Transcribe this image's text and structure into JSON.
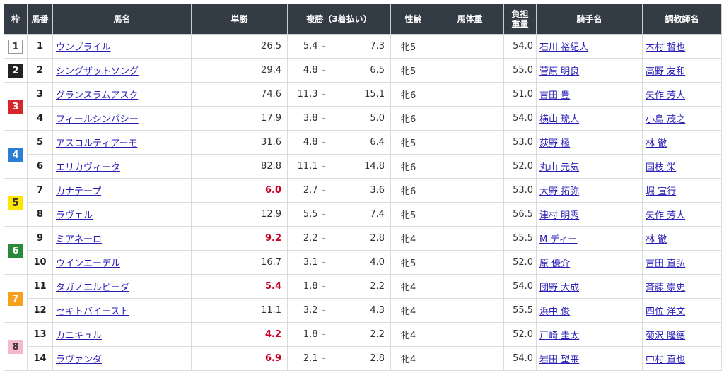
{
  "headers": {
    "waku": "枠",
    "umaban": "馬番",
    "name": "馬名",
    "tansho": "単勝",
    "fukusho": "複勝（3着払い）",
    "sexage": "性齢",
    "bodyweight": "馬体重",
    "weight_line1": "負担",
    "weight_line2": "重量",
    "jockey": "騎手名",
    "trainer": "調教師名"
  },
  "waku_colors": {
    "1": {
      "bg": "#ffffff",
      "fg": "#333333",
      "border": "#999999"
    },
    "2": {
      "bg": "#222222",
      "fg": "#ffffff",
      "border": "#222222"
    },
    "3": {
      "bg": "#d8262d",
      "fg": "#ffffff",
      "border": "#d8262d"
    },
    "4": {
      "bg": "#2a7fd4",
      "fg": "#ffffff",
      "border": "#2a7fd4"
    },
    "5": {
      "bg": "#ffe600",
      "fg": "#333333",
      "border": "#ffe600"
    },
    "6": {
      "bg": "#2a8a3a",
      "fg": "#ffffff",
      "border": "#2a8a3a"
    },
    "7": {
      "bg": "#f7a01e",
      "fg": "#ffffff",
      "border": "#f7a01e"
    },
    "8": {
      "bg": "#f5b8cc",
      "fg": "#333333",
      "border": "#f5b8cc"
    }
  },
  "rows": [
    {
      "waku": "1",
      "umaban": "1",
      "name": "ウンブライル",
      "tansho": "26.5",
      "popular": false,
      "fuku_min": "5.4",
      "fuku_max": "7.3",
      "sexage": "牝5",
      "bodyweight": "",
      "weight": "54.0",
      "jockey": "石川 裕紀人",
      "trainer": "木村 哲也"
    },
    {
      "waku": "2",
      "umaban": "2",
      "name": "シングザットソング",
      "tansho": "29.4",
      "popular": false,
      "fuku_min": "4.8",
      "fuku_max": "6.5",
      "sexage": "牝5",
      "bodyweight": "",
      "weight": "55.0",
      "jockey": "菅原 明良",
      "trainer": "高野 友和"
    },
    {
      "waku": "3",
      "umaban": "3",
      "name": "グランスラムアスク",
      "tansho": "74.6",
      "popular": false,
      "fuku_min": "11.3",
      "fuku_max": "15.1",
      "sexage": "牝6",
      "bodyweight": "",
      "weight": "51.0",
      "jockey": "吉田 豊",
      "trainer": "矢作 芳人"
    },
    {
      "waku": "3",
      "umaban": "4",
      "name": "フィールシンパシー",
      "tansho": "17.9",
      "popular": false,
      "fuku_min": "3.8",
      "fuku_max": "5.0",
      "sexage": "牝6",
      "bodyweight": "",
      "weight": "54.0",
      "jockey": "横山 琉人",
      "trainer": "小島 茂之"
    },
    {
      "waku": "4",
      "umaban": "5",
      "name": "アスコルティアーモ",
      "tansho": "31.6",
      "popular": false,
      "fuku_min": "4.8",
      "fuku_max": "6.4",
      "sexage": "牝5",
      "bodyweight": "",
      "weight": "53.0",
      "jockey": "荻野 極",
      "trainer": "林 徹"
    },
    {
      "waku": "4",
      "umaban": "6",
      "name": "エリカヴィータ",
      "tansho": "82.8",
      "popular": false,
      "fuku_min": "11.1",
      "fuku_max": "14.8",
      "sexage": "牝6",
      "bodyweight": "",
      "weight": "52.0",
      "jockey": "丸山 元気",
      "trainer": "国枝 栄"
    },
    {
      "waku": "5",
      "umaban": "7",
      "name": "カナテープ",
      "tansho": "6.0",
      "popular": true,
      "fuku_min": "2.7",
      "fuku_max": "3.6",
      "sexage": "牝6",
      "bodyweight": "",
      "weight": "53.0",
      "jockey": "大野 拓弥",
      "trainer": "堀 宣行"
    },
    {
      "waku": "5",
      "umaban": "8",
      "name": "ラヴェル",
      "tansho": "12.9",
      "popular": false,
      "fuku_min": "5.5",
      "fuku_max": "7.4",
      "sexage": "牝5",
      "bodyweight": "",
      "weight": "56.5",
      "jockey": "津村 明秀",
      "trainer": "矢作 芳人"
    },
    {
      "waku": "6",
      "umaban": "9",
      "name": "ミアネーロ",
      "tansho": "9.2",
      "popular": true,
      "fuku_min": "2.2",
      "fuku_max": "2.8",
      "sexage": "牝4",
      "bodyweight": "",
      "weight": "55.5",
      "jockey": "M.ディー",
      "trainer": "林 徹"
    },
    {
      "waku": "6",
      "umaban": "10",
      "name": "ウインエーデル",
      "tansho": "16.7",
      "popular": false,
      "fuku_min": "3.1",
      "fuku_max": "4.0",
      "sexage": "牝5",
      "bodyweight": "",
      "weight": "52.0",
      "jockey": "原 優介",
      "trainer": "吉田 直弘"
    },
    {
      "waku": "7",
      "umaban": "11",
      "name": "タガノエルピーダ",
      "tansho": "5.4",
      "popular": true,
      "fuku_min": "1.8",
      "fuku_max": "2.2",
      "sexage": "牝4",
      "bodyweight": "",
      "weight": "54.0",
      "jockey": "団野 大成",
      "trainer": "斉藤 崇史"
    },
    {
      "waku": "7",
      "umaban": "12",
      "name": "セキトバイースト",
      "tansho": "11.1",
      "popular": false,
      "fuku_min": "3.2",
      "fuku_max": "4.3",
      "sexage": "牝4",
      "bodyweight": "",
      "weight": "55.5",
      "jockey": "浜中 俊",
      "trainer": "四位 洋文"
    },
    {
      "waku": "8",
      "umaban": "13",
      "name": "カニキュル",
      "tansho": "4.2",
      "popular": true,
      "fuku_min": "1.8",
      "fuku_max": "2.2",
      "sexage": "牝4",
      "bodyweight": "",
      "weight": "52.0",
      "jockey": "戸崎 圭太",
      "trainer": "菊沢 隆徳"
    },
    {
      "waku": "8",
      "umaban": "14",
      "name": "ラヴァンダ",
      "tansho": "6.9",
      "popular": true,
      "fuku_min": "2.1",
      "fuku_max": "2.8",
      "sexage": "牝4",
      "bodyweight": "",
      "weight": "54.0",
      "jockey": "岩田 望来",
      "trainer": "中村 直也"
    }
  ]
}
